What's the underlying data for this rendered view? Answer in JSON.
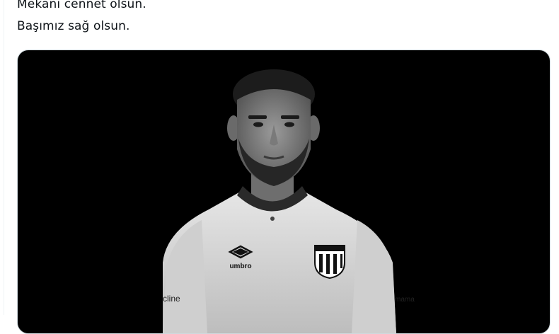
{
  "tweet": {
    "lines": [
      "Mekanı cennet olsun.",
      "Başımız sağ olsun."
    ]
  },
  "media": {
    "kit_brand": "umbro",
    "sponsor_left": "cline",
    "sponsor_right": "mama"
  },
  "colors": {
    "text": "#0f1419",
    "media_bg": "#000000",
    "border": "#cfd9de",
    "shirt": "#d9d9d9"
  }
}
